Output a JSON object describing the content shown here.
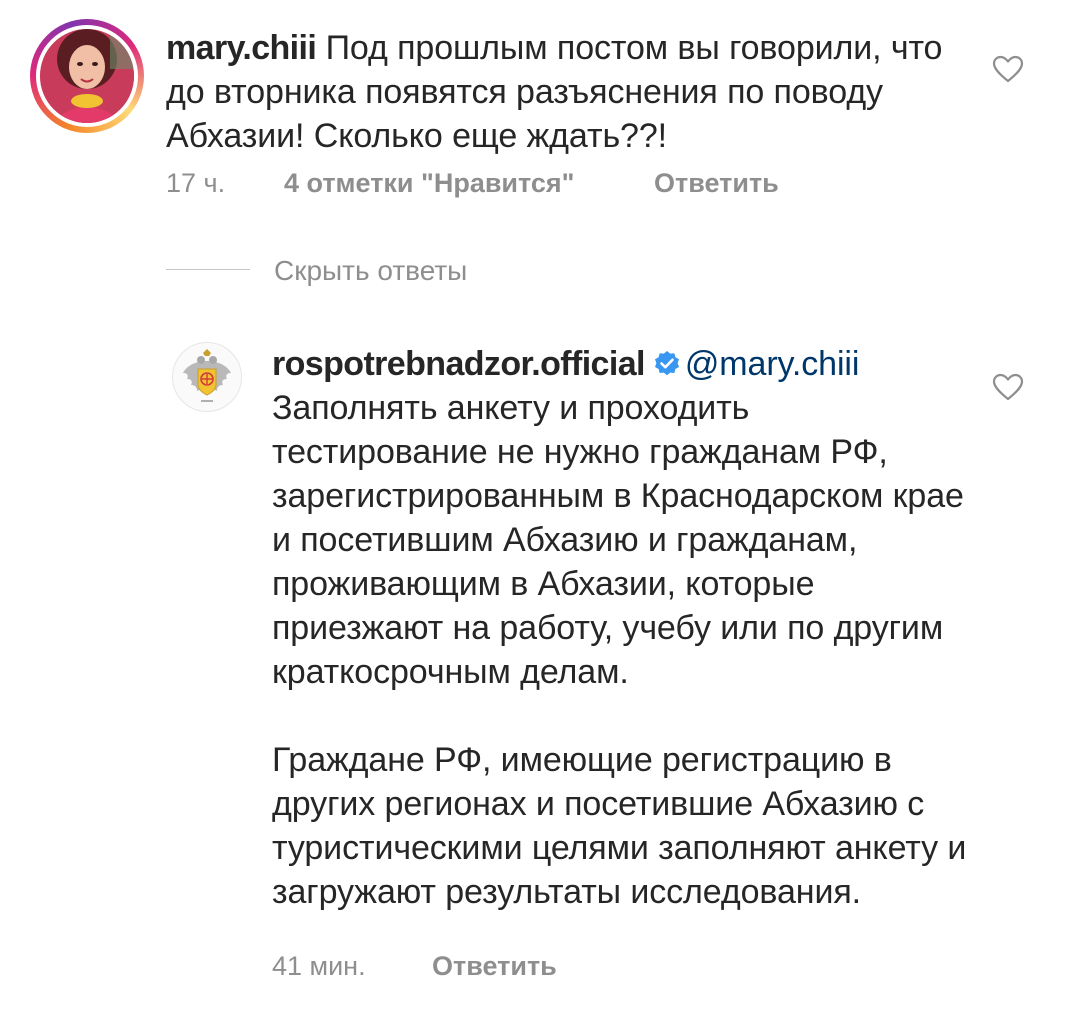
{
  "comments": [
    {
      "username": "mary.chiii",
      "text": "Под прошлым постом вы говорили, что до вторника появятся разъяснения по поводу Абхазии! Сколько еще ждать??!",
      "time": "17 ч.",
      "likes": "4 отметки \"Нравится\"",
      "reply_label": "Ответить",
      "avatar_icon": "user-photo-avatar",
      "like_icon": "heart-outline-icon"
    }
  ],
  "replies_toggle": {
    "label": "Скрыть ответы"
  },
  "reply": {
    "username": "rospotrebnadzor.official",
    "verified_icon": "verified-badge-icon",
    "mention": "@mary.chiii",
    "paragraphs": [
      "Заполнять анкету и проходить тестирование не нужно гражданам РФ, зарегистрированным в Краснодарском крае и посетившим Абхазию и гражданам, проживающим в Абхазии, которые приезжают на работу, учебу или по другим краткосрочным делам.",
      "Граждане РФ, имеющие регистрацию в других регионах и посетившие Абхазию с туристическими целями заполняют анкету и загружают результаты исследования."
    ],
    "time": "41 мин.",
    "reply_label": "Ответить",
    "avatar_icon": "emblem-avatar",
    "like_icon": "heart-outline-icon"
  },
  "colors": {
    "text": "#262626",
    "secondary": "#8e8e8e",
    "verified": "#3897f0",
    "mention": "#00376b"
  }
}
